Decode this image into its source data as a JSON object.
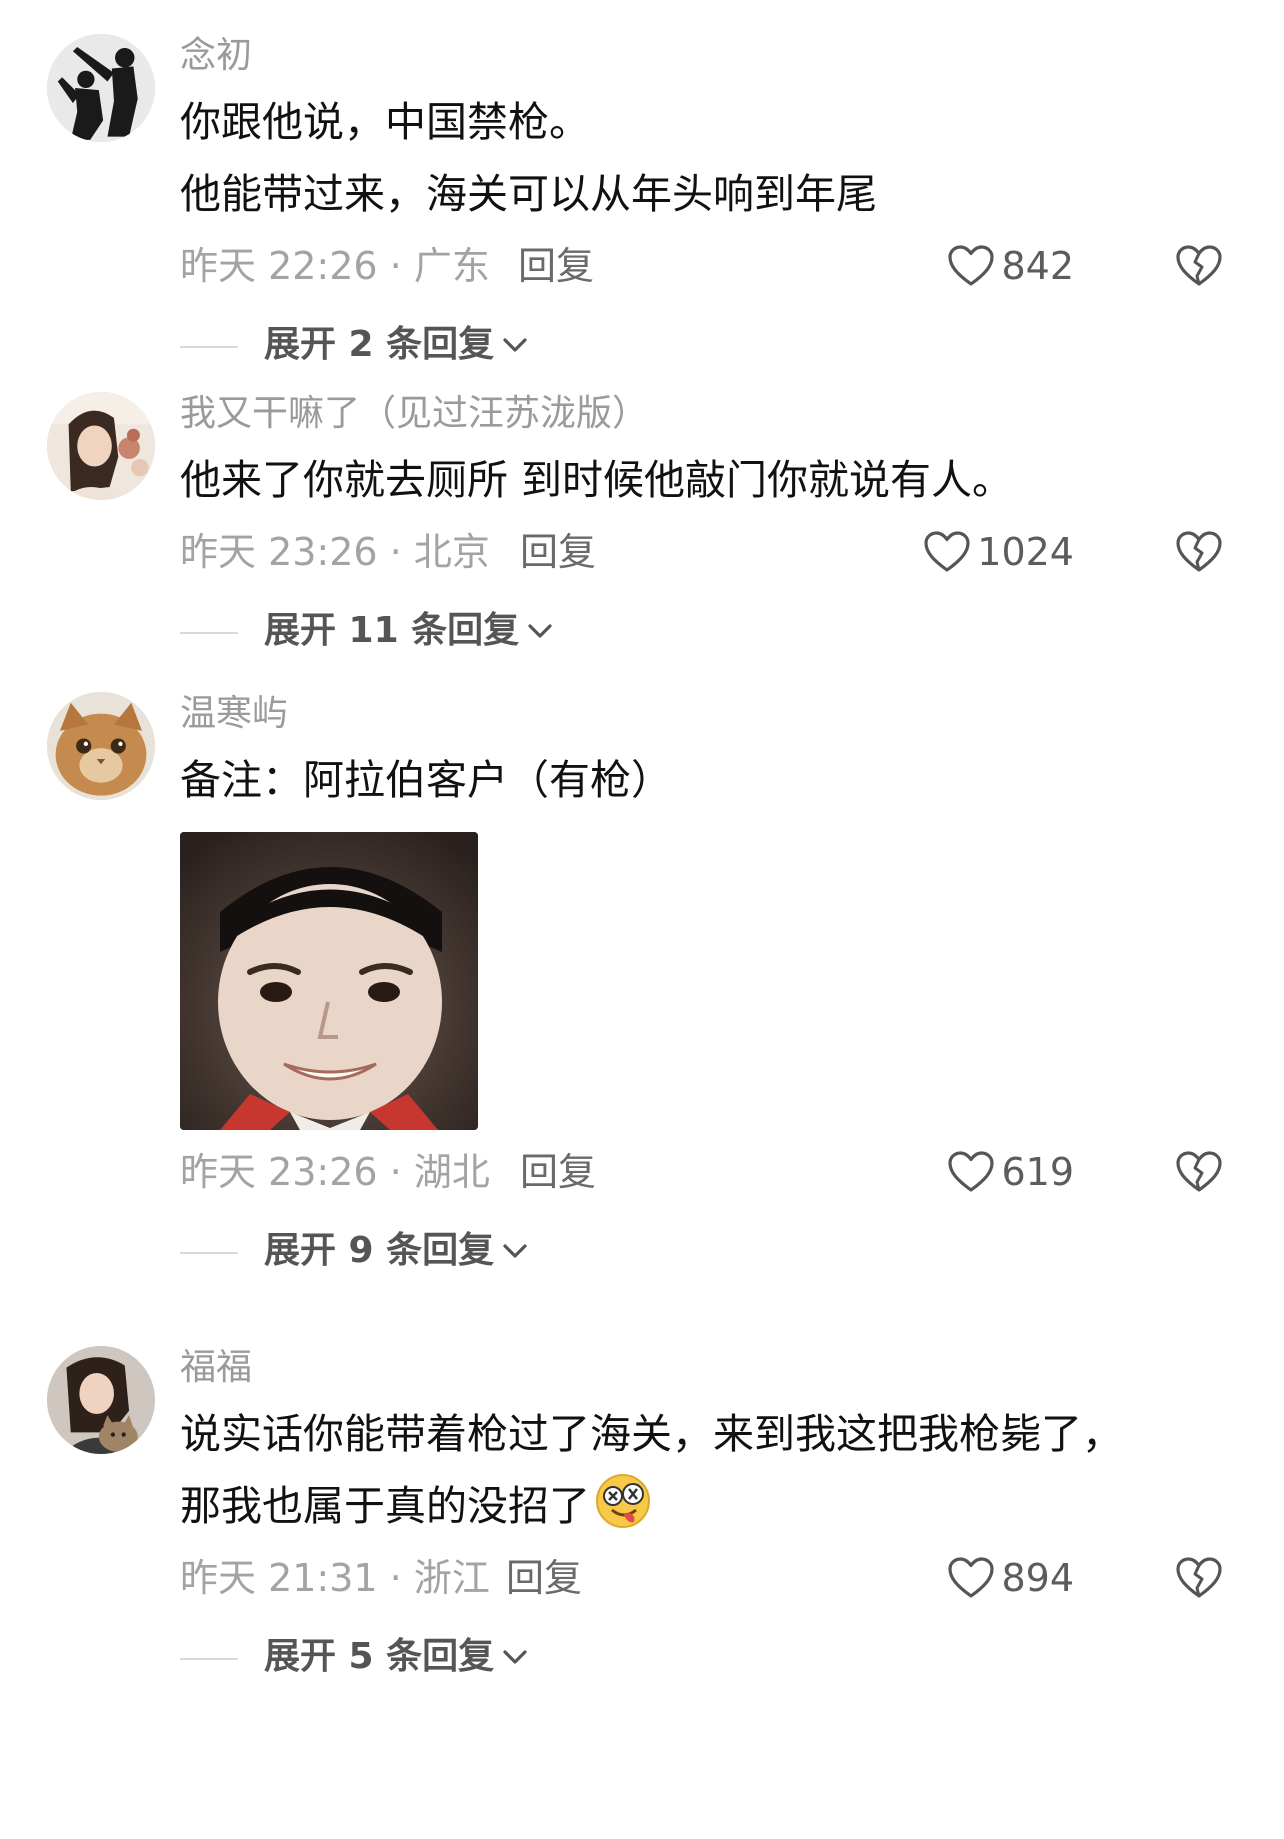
{
  "comments": [
    {
      "username": "念初",
      "lines": [
        "你跟他说，中国禁枪。",
        "他能带过来，海关可以从年头响到年尾"
      ],
      "time_location": "昨天 22:26 · 广东",
      "reply_label": "回复",
      "likes": "842",
      "expand_label": "展开 2 条回复"
    },
    {
      "username": "我又干嘛了（见过汪苏泷版）",
      "lines": [
        "他来了你就去厕所 到时候他敲门你就说有人。"
      ],
      "time_location": "昨天 23:26 · 北京",
      "reply_label": "回复",
      "likes": "1024",
      "expand_label": "展开 11 条回复"
    },
    {
      "username": "温寒屿",
      "lines": [
        "备注：阿拉伯客户（有枪）"
      ],
      "time_location": "昨天 23:26 · 湖北",
      "reply_label": "回复",
      "likes": "619",
      "expand_label": "展开 9 条回复",
      "has_sticker": true
    },
    {
      "username": "福福",
      "lines": [
        "说实话你能带着枪过了海关，来到我这把我枪毙了，",
        "那我也属于真的没招了"
      ],
      "time_location": "昨天 21:31 · 浙江",
      "reply_label": "回复",
      "likes": "894",
      "expand_label": "展开 5 条回复",
      "trailing_emoji": "silly-face-emoji"
    }
  ],
  "icons": {
    "like": "heart-outline-icon",
    "dislike": "broken-heart-icon",
    "expand": "chevron-down-icon"
  },
  "colors": {
    "username": "#9a9a9a",
    "text": "#111111",
    "meta": "#a3a3a3",
    "reply": "#6a6a6a"
  }
}
